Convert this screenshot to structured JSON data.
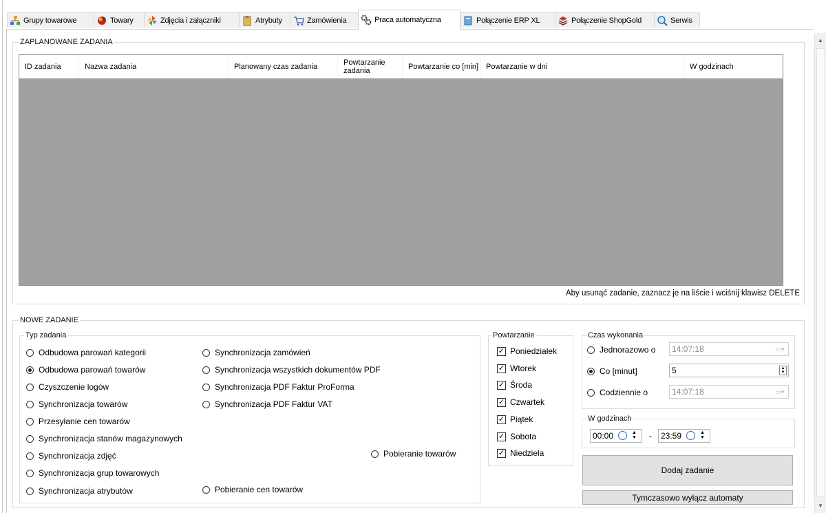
{
  "tabs": [
    {
      "label": "Grupy towarowe",
      "icon": "tree-icon"
    },
    {
      "label": "Towary",
      "icon": "products-icon"
    },
    {
      "label": "Zdjęcia i załączniki",
      "icon": "pinwheel-icon"
    },
    {
      "label": "Atrybuty",
      "icon": "clipboard-icon"
    },
    {
      "label": "Zamówienia",
      "icon": "cart-icon"
    },
    {
      "label": "Praca automatyczna",
      "icon": "gears-icon",
      "active": true
    },
    {
      "label": "Połączenie ERP XL",
      "icon": "database-icon"
    },
    {
      "label": "Połączenie ShopGold",
      "icon": "layers-icon"
    },
    {
      "label": "Serwis",
      "icon": "magnifier-icon"
    }
  ],
  "scheduled": {
    "group_title": "ZAPLANOWANE ZADANIA",
    "columns": [
      "ID zadania",
      "Nazwa zadania",
      "Planowany czas zadania",
      "Powtarzanie zadania",
      "Powtarzanie co [min]",
      "Powtarzanie w dni",
      "W godzinach"
    ],
    "rows": [],
    "hint": "Aby usunąć zadanie, zaznacz je na liście i wciśnij klawisz DELETE"
  },
  "new_task": {
    "group_title": "NOWE ZADANIE",
    "type_group_title": "Typ zadania",
    "types": [
      {
        "label": "Odbudowa parowań kategorii",
        "selected": false
      },
      {
        "label": "Odbudowa parowań towarów",
        "selected": true
      },
      {
        "label": "Czyszczenie logów",
        "selected": false
      },
      {
        "label": "Synchronizacja towarów",
        "selected": false
      },
      {
        "label": "Przesyłanie cen towarów",
        "selected": false
      },
      {
        "label": "Synchronizacja stanów magazynowych",
        "selected": false
      },
      {
        "label": "Synchronizacja zdjęć",
        "selected": false
      },
      {
        "label": "Synchronizacja grup towarowych",
        "selected": false
      },
      {
        "label": "Synchronizacja atrybutów",
        "selected": false
      },
      {
        "label": "Synchronizacja zamówień",
        "selected": false
      },
      {
        "label": "Synchronizacja wszystkich dokumentów PDF",
        "selected": false
      },
      {
        "label": "Synchronizacja PDF Faktur ProForma",
        "selected": false
      },
      {
        "label": "Synchronizacja PDF Faktur VAT",
        "selected": false
      },
      {
        "label": "Pobieranie towarów",
        "selected": false
      },
      {
        "label": "Pobieranie cen towarów",
        "selected": false
      }
    ],
    "repeat_group_title": "Powtarzanie",
    "days": [
      {
        "label": "Poniedziałek",
        "checked": true
      },
      {
        "label": "Wtorek",
        "checked": true
      },
      {
        "label": "Środa",
        "checked": true
      },
      {
        "label": "Czwartek",
        "checked": true
      },
      {
        "label": "Piątek",
        "checked": true
      },
      {
        "label": "Sobota",
        "checked": true
      },
      {
        "label": "Niedziela",
        "checked": true
      }
    ],
    "exec_group_title": "Czas wykonania",
    "once_label": "Jednorazowo o",
    "once_value": "14:07:18",
    "every_label": "Co [minut]",
    "every_value": "5",
    "daily_label": "Codziennie o",
    "daily_value": "14:07:18",
    "exec_mode": "every",
    "hours_group_title": "W godzinach",
    "hours_from": "00:00",
    "hours_sep": "-",
    "hours_to": "23:59",
    "add_button": "Dodaj zadanie",
    "disable_button": "Tymczasowo wyłącz automaty"
  },
  "colors": {
    "grid_background": "#a0a0a0",
    "selected_tab": "#ffffff"
  }
}
